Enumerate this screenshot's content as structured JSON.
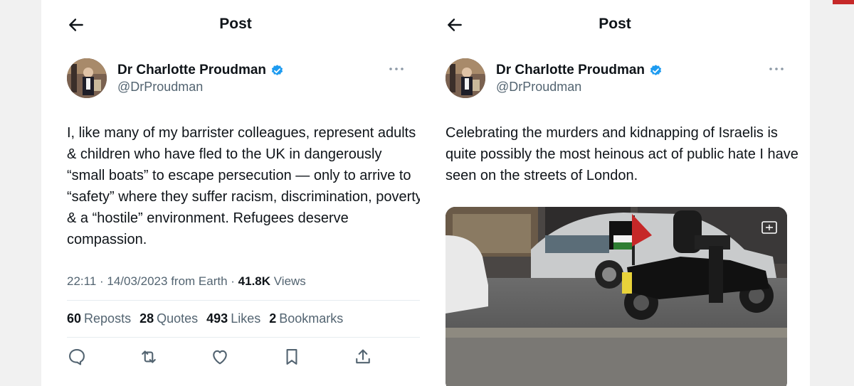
{
  "posts": [
    {
      "header_title": "Post",
      "author_name": "Dr Charlotte Proudman",
      "author_handle": "@DrProudman",
      "text": "I, like many of my barrister colleagues, represent adults & children who have fled to the UK in dangerously “small boats” to escape persecution — only to arrive to “safety” where they suffer racism, discrimination, poverty & a “hostile” environment. Refugees deserve compassion.",
      "meta": {
        "time_date": "22:11 · 14/03/2023 from Earth · ",
        "views_count": "41.8K",
        "views_label": " Views"
      },
      "stats": {
        "reposts_count": "60",
        "reposts_label": "Reposts",
        "quotes_count": "28",
        "quotes_label": "Quotes",
        "likes_count": "493",
        "likes_label": "Likes",
        "bookmarks_count": "2",
        "bookmarks_label": "Bookmarks"
      },
      "actions": [
        "reply-icon",
        "repost-icon",
        "like-icon",
        "bookmark-icon",
        "share-icon"
      ]
    },
    {
      "header_title": "Post",
      "author_name": "Dr Charlotte Proudman",
      "author_handle": "@DrProudman",
      "text": "Celebrating the murders and kidnapping of Israelis is quite possibly the most heinous act of public hate I have seen on the streets of London.",
      "media": "video-still: street scene with motorcycle carrying Palestinian flag past a silver car"
    }
  ],
  "colors": {
    "verified": "#1d9bf0",
    "secondary_text": "#536471",
    "primary_text": "#0f1419"
  }
}
